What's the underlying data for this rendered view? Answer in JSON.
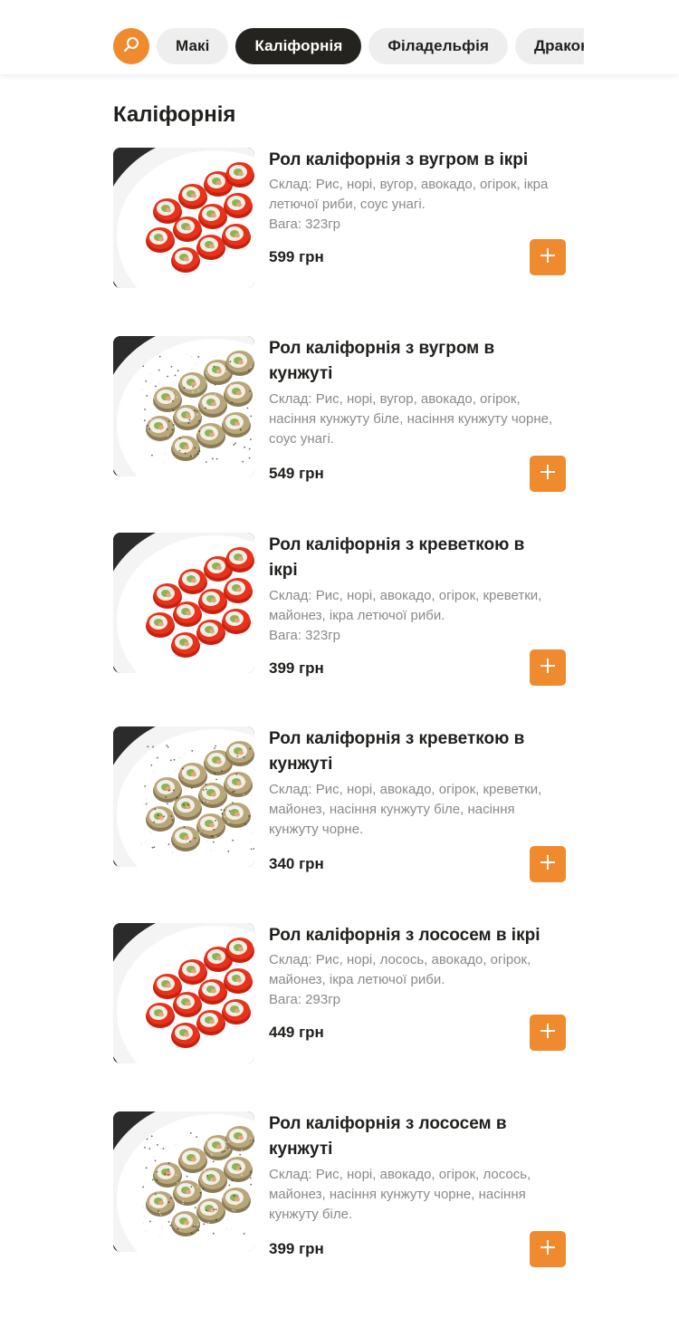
{
  "nav": {
    "search_icon": "search-icon",
    "chips": [
      {
        "label": "Макі",
        "active": false
      },
      {
        "label": "Каліфорнія",
        "active": true
      },
      {
        "label": "Філадельфія",
        "active": false
      },
      {
        "label": "Дракон",
        "active": false
      }
    ]
  },
  "section": {
    "title": "Каліфорнія"
  },
  "products": [
    {
      "name": "Рол каліфорнія з вугром в ікрі",
      "description": "Склад: Рис, норі, вугор, авокадо, огірок, ікра летючої риби, соус унагі.",
      "weight": "Вага: 323гр",
      "price": "599 грн",
      "coating": "roe"
    },
    {
      "name": "Рол каліфорнія з вугром в кунжуті",
      "description": "Склад: Рис, норі, вугор, авокадо, огірок, насіння кунжуту біле, насіння кунжуту чорне, соус унагі.",
      "weight": "",
      "price": "549 грн",
      "coating": "sesame"
    },
    {
      "name": "Рол каліфорнія з креветкою в ікрі",
      "description": "Склад: Рис, норі, авокадо, огірок, креветки, майонез, ікра летючої риби.",
      "weight": "Вага: 323гр",
      "price": "399 грн",
      "coating": "roe"
    },
    {
      "name": "Рол каліфорнія з креветкою в кунжуті",
      "description": "Склад: Рис, норі, авокадо, огірок, креветки, майонез, насіння кунжуту біле, насіння кунжуту чорне.",
      "weight": "",
      "price": "340 грн",
      "coating": "sesame"
    },
    {
      "name": "Рол каліфорнія з лососем в ікрі",
      "description": "Склад: Рис, норі, лосось, авокадо, огірок, майонез, ікра летючої риби.",
      "weight": "Вага: 293гр",
      "price": "449 грн",
      "coating": "roe"
    },
    {
      "name": "Рол каліфорнія з лососем в кунжуті",
      "description": "Склад: Рис, норі, авокадо, огірок, лосось, майонез, насіння кунжуту чорне, насіння кунжуту біле.",
      "weight": "",
      "price": "399 грн",
      "coating": "sesame"
    }
  ],
  "add_icon": "plus-icon",
  "colors": {
    "accent": "#f08a2e",
    "active_chip": "#24231f",
    "chip": "#eeeeee",
    "muted_text": "#8a8a8a"
  }
}
